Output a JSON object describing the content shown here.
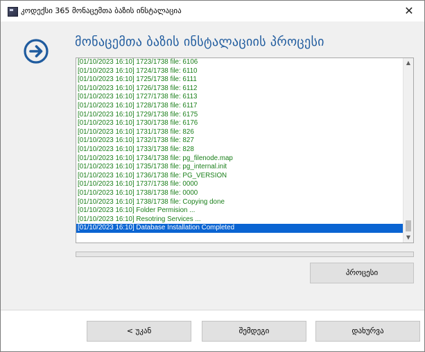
{
  "window": {
    "title": "კოდექსი 365 მონაცემთა ბაზის ინსტალაცია",
    "close_glyph": "✕"
  },
  "heading": "მონაცემთა ბაზის ინსტალაციის პროცესი",
  "icons": {
    "app": "app-icon",
    "arrow": "arrow-right-circle-icon",
    "close": "close-icon",
    "scroll_up": "chevron-up-icon",
    "scroll_down": "chevron-down-icon"
  },
  "colors": {
    "accent": "#1f5b9e",
    "log_text": "#1a7f1a",
    "selection": "#0a64d2",
    "progress": "#06b025"
  },
  "log": {
    "lines": [
      "[01/10/2023 16:10]  1723/1738 file: 6106",
      "[01/10/2023 16:10]  1724/1738 file: 6110",
      "[01/10/2023 16:10]  1725/1738 file: 6111",
      "[01/10/2023 16:10]  1726/1738 file: 6112",
      "[01/10/2023 16:10]  1727/1738 file: 6113",
      "[01/10/2023 16:10]  1728/1738 file: 6117",
      "[01/10/2023 16:10]  1729/1738 file: 6175",
      "[01/10/2023 16:10]  1730/1738 file: 6176",
      "[01/10/2023 16:10]  1731/1738 file: 826",
      "[01/10/2023 16:10]  1732/1738 file: 827",
      "[01/10/2023 16:10]  1733/1738 file: 828",
      "[01/10/2023 16:10]  1734/1738 file: pg_filenode.map",
      "[01/10/2023 16:10]  1735/1738 file: pg_internal.init",
      "[01/10/2023 16:10]  1736/1738 file: PG_VERSION",
      "[01/10/2023 16:10]  1737/1738 file: 0000",
      "[01/10/2023 16:10]  1738/1738 file: 0000",
      "[01/10/2023 16:10]  1738/1738 file: Copying done",
      "[01/10/2023 16:10] Folder Permision ...",
      "[01/10/2023 16:10] Resotring Services ...",
      "[01/10/2023 16:10] Database Installation Completed"
    ],
    "selected_index": 19
  },
  "progress": {
    "value": 0
  },
  "buttons": {
    "process": "პროცესი",
    "back": "< უკან",
    "next": "შემდეგი",
    "close": "დახურვა"
  }
}
